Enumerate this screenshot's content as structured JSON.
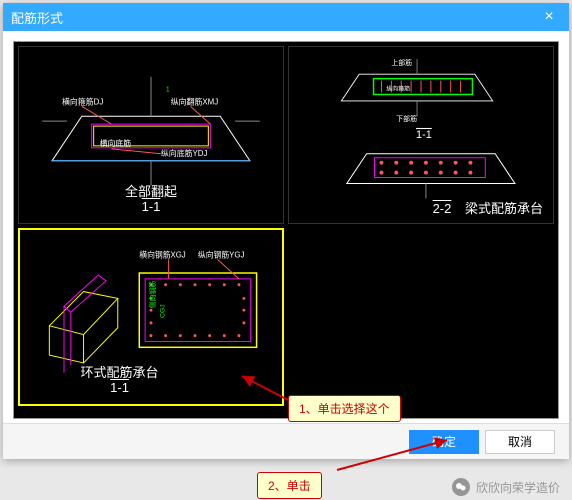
{
  "dialog": {
    "title": "配筋形式",
    "close_label": "×"
  },
  "options": [
    {
      "caption": "全部翻起",
      "section": "1-1",
      "labels": {
        "h1": "横向箍筋DJ",
        "h2": "纵向翻筋XMJ",
        "h3": "横向底筋",
        "h4": "纵向底筋YDJ"
      },
      "selected": false
    },
    {
      "caption": "梁式配筋承台",
      "section": "2-2",
      "sections_extra": "1-1",
      "labels": {
        "t1": "上部筋",
        "t2": "纵向箍筋",
        "t3": "下部筋"
      },
      "selected": false
    },
    {
      "caption": "环式配筋承台",
      "section": "1-1",
      "labels": {
        "h1": "横向钢筋XGJ",
        "h2": "纵向钢筋YGJ"
      },
      "selected": true
    }
  ],
  "buttons": {
    "ok": "确定",
    "cancel": "取消"
  },
  "annotations": {
    "callout1": "1、单击选择这个",
    "callout2": "2、单击"
  },
  "watermark": "欣欣向荣学造价",
  "colors": {
    "titlebar": "#33aaff",
    "primary": "#1e90ff",
    "callout_bg": "#ffffcc",
    "callout_border": "#cc0000"
  }
}
